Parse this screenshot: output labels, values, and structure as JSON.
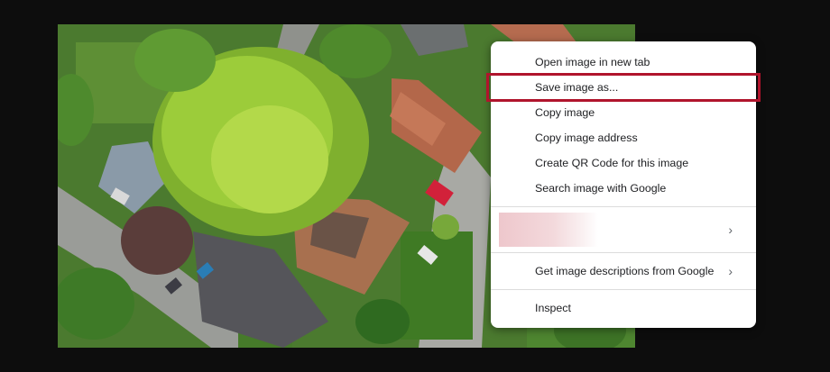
{
  "context_menu": {
    "items": [
      {
        "label": "Open image in new tab"
      },
      {
        "label": "Save image as..."
      },
      {
        "label": "Copy image"
      },
      {
        "label": "Copy image address"
      },
      {
        "label": "Create QR Code for this image"
      },
      {
        "label": "Search image with Google"
      }
    ],
    "extension_item": {
      "chevron": "›",
      "icon": "chevron-right-icon"
    },
    "descriptions_item": {
      "label": "Get image descriptions from Google",
      "chevron": "›"
    },
    "inspect_item": {
      "label": "Inspect"
    },
    "highlight_color": "#b0142c"
  }
}
